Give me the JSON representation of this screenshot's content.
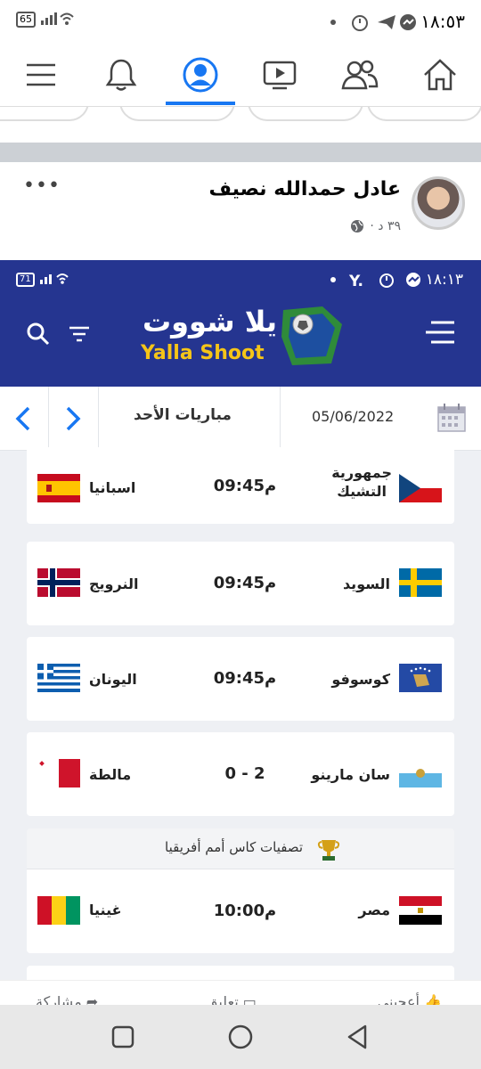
{
  "status_bar": {
    "time": "١٨:٥٣",
    "battery": "65"
  },
  "nav": {
    "icons": [
      "menu-icon",
      "bell-icon",
      "profile-icon",
      "video-icon",
      "friends-icon",
      "home-icon"
    ],
    "active": "profile-icon",
    "accent": "#1877f2"
  },
  "post": {
    "author": "عادل حمدالله نصيف",
    "time": "٣٩ د ·"
  },
  "shot": {
    "status_time": "١٨:١٣",
    "battery": "71",
    "brand_ar": "يلا شووت",
    "brand_en": "Yalla Shoot",
    "header_color": "#253590",
    "date": "05/06/2022",
    "day": "مباريات الأحد",
    "matches": [
      {
        "home": "جمهورية التشيك",
        "home_l1": "جمهورية",
        "home_l2": "التشيك",
        "away": "اسبانيا",
        "score": "09:45م"
      },
      {
        "home": "السويد",
        "away": "النرويج",
        "score": "09:45م"
      },
      {
        "home": "كوسوفو",
        "away": "اليونان",
        "score": "09:45م"
      },
      {
        "home": "سان مارينو",
        "away": "مالطة",
        "score": "0  -  2"
      }
    ],
    "competition": "تصفيات كاس أمم أفريقيا",
    "cup_match": {
      "home": "مصر",
      "away": "غينيا",
      "score": "10:00م"
    }
  },
  "actions": {
    "like": "أعجبني",
    "comment": "تعليق",
    "share": "مشاركة"
  }
}
